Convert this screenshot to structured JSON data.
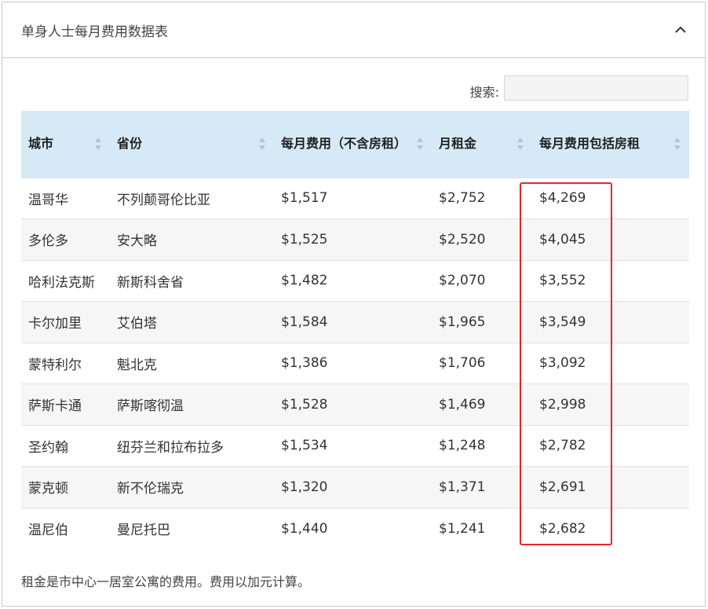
{
  "panel": {
    "title": "单身人士每月费用数据表",
    "collapse_icon": "chevron-up-icon"
  },
  "search": {
    "label": "搜索:",
    "value": "",
    "placeholder": ""
  },
  "table": {
    "headers": [
      "城市",
      "省份",
      "每月费用（不含房租）",
      "月租金",
      "每月费用包括房租"
    ],
    "rows": [
      [
        "温哥华",
        "不列颠哥伦比亚",
        "$1,517",
        "$2,752",
        "$4,269"
      ],
      [
        "多伦多",
        "安大略",
        "$1,525",
        "$2,520",
        "$4,045"
      ],
      [
        "哈利法克斯",
        "新斯科舍省",
        "$1,482",
        "$2,070",
        "$3,552"
      ],
      [
        "卡尔加里",
        "艾伯塔",
        "$1,584",
        "$1,965",
        "$3,549"
      ],
      [
        "蒙特利尔",
        "魁北克",
        "$1,386",
        "$1,706",
        "$3,092"
      ],
      [
        "萨斯卡通",
        "萨斯喀彻温",
        "$1,528",
        "$1,469",
        "$2,998"
      ],
      [
        "圣约翰",
        "纽芬兰和拉布拉多",
        "$1,534",
        "$1,248",
        "$2,782"
      ],
      [
        "蒙克顿",
        "新不伦瑞克",
        "$1,320",
        "$1,371",
        "$2,691"
      ],
      [
        "温尼伯",
        "曼尼托巴",
        "$1,440",
        "$1,241",
        "$2,682"
      ]
    ]
  },
  "highlight_color": "#e8242a",
  "header_bg": "#d5eaf6",
  "footnote": "租金是市中心一居室公寓的费用。费用以加元计算。"
}
